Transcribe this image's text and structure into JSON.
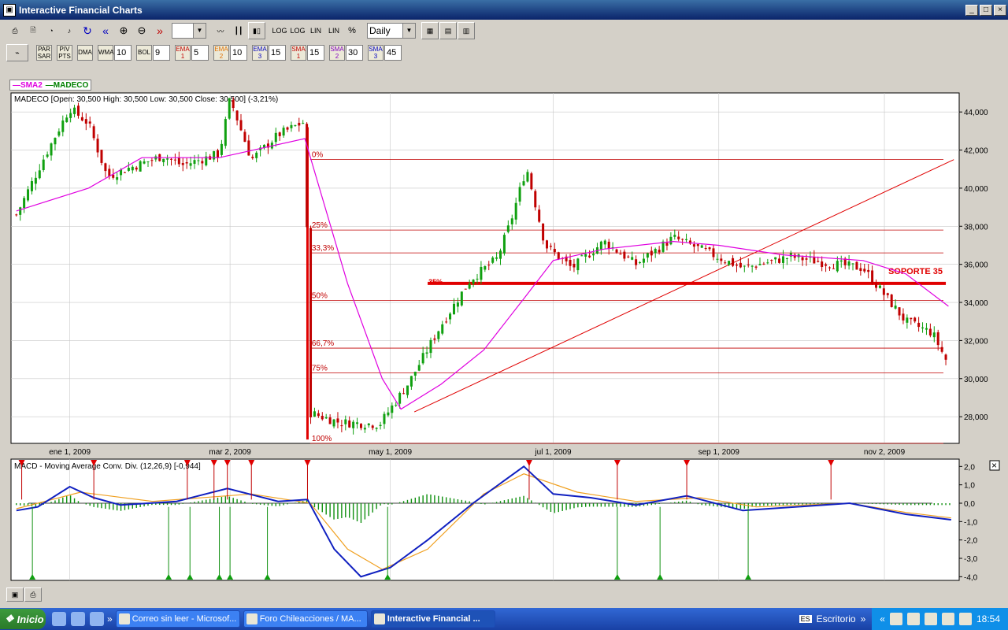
{
  "window": {
    "title": "Interactive Financial Charts"
  },
  "toolbar1": {
    "log1": "LOG",
    "log2": "LOG",
    "lin1": "LIN",
    "lin2": "LIN",
    "pct": "%",
    "period": "Daily"
  },
  "toolbar2": {
    "par": "PAR SAR",
    "piv": "PIV PTS",
    "dma": "DMA",
    "wma": "WMA",
    "wma_val": "10",
    "bol": "BOL",
    "bol_val": "9",
    "ema1": "EMA 1",
    "ema1_val": "5",
    "ema2": "EMA 2",
    "ema2_val": "10",
    "ema3": "EMA 3",
    "ema3_val": "15",
    "sma1": "SMA 1",
    "sma1_val": "15",
    "sma2": "SMA 2",
    "sma2_val": "30",
    "sma3": "SMA 3",
    "sma3_val": "45"
  },
  "legend": {
    "sma": "SMA2",
    "symbol": "MADECO",
    "sma_color": "#e000e0",
    "symbol_color": "#008000"
  },
  "chart_data": [
    {
      "type": "candlestick",
      "title": "MADECO [Open: 30,500  High: 30,500  Low: 30,500  Close: 30,500] (-3,21%)",
      "ylim": [
        26600,
        45000
      ],
      "y_ticks": [
        "44,000",
        "42,000",
        "40,000",
        "38,000",
        "36,000",
        "34,000",
        "32,000",
        "30,000",
        "28,000"
      ],
      "y_tick_values": [
        44000,
        42000,
        40000,
        38000,
        36000,
        34000,
        32000,
        30000,
        28000
      ],
      "x_ticks": [
        "ene 1, 2009",
        "mar 2, 2009",
        "may 1, 2009",
        "jul 1, 2009",
        "sep 1, 2009",
        "nov 2, 2009"
      ],
      "x_range": [
        "2008-12-10",
        "2009-11-30"
      ],
      "close_path": [
        {
          "d": "2008-12-12",
          "v": 38600
        },
        {
          "d": "2008-12-22",
          "v": 41500
        },
        {
          "d": "2009-01-01",
          "v": 44200
        },
        {
          "d": "2009-01-08",
          "v": 43400
        },
        {
          "d": "2009-01-15",
          "v": 40600
        },
        {
          "d": "2009-01-22",
          "v": 41000
        },
        {
          "d": "2009-02-05",
          "v": 41700
        },
        {
          "d": "2009-02-12",
          "v": 41200
        },
        {
          "d": "2009-02-26",
          "v": 41800
        },
        {
          "d": "2009-03-02",
          "v": 44700
        },
        {
          "d": "2009-03-10",
          "v": 41500
        },
        {
          "d": "2009-03-20",
          "v": 42800
        },
        {
          "d": "2009-03-30",
          "v": 43500
        },
        {
          "d": "2009-04-01",
          "v": 28200
        },
        {
          "d": "2009-04-12",
          "v": 27700
        },
        {
          "d": "2009-04-27",
          "v": 27600
        },
        {
          "d": "2009-05-08",
          "v": 29800
        },
        {
          "d": "2009-05-20",
          "v": 32800
        },
        {
          "d": "2009-05-31",
          "v": 35200
        },
        {
          "d": "2009-06-10",
          "v": 36300
        },
        {
          "d": "2009-06-15",
          "v": 38200
        },
        {
          "d": "2009-06-21",
          "v": 41100
        },
        {
          "d": "2009-06-28",
          "v": 37000
        },
        {
          "d": "2009-07-08",
          "v": 35800
        },
        {
          "d": "2009-07-20",
          "v": 37200
        },
        {
          "d": "2009-08-01",
          "v": 36000
        },
        {
          "d": "2009-08-15",
          "v": 37400
        },
        {
          "d": "2009-08-25",
          "v": 36800
        },
        {
          "d": "2009-09-10",
          "v": 35800
        },
        {
          "d": "2009-09-28",
          "v": 36400
        },
        {
          "d": "2009-10-10",
          "v": 36100
        },
        {
          "d": "2009-10-25",
          "v": 35800
        },
        {
          "d": "2009-11-02",
          "v": 34400
        },
        {
          "d": "2009-11-10",
          "v": 33000
        },
        {
          "d": "2009-11-20",
          "v": 32400
        },
        {
          "d": "2009-11-25",
          "v": 31000
        }
      ],
      "sma_path": [
        {
          "d": "2008-12-12",
          "v": 38800
        },
        {
          "d": "2009-01-08",
          "v": 40000
        },
        {
          "d": "2009-01-28",
          "v": 41600
        },
        {
          "d": "2009-02-26",
          "v": 41600
        },
        {
          "d": "2009-03-30",
          "v": 42600
        },
        {
          "d": "2009-04-15",
          "v": 35000
        },
        {
          "d": "2009-04-28",
          "v": 30000
        },
        {
          "d": "2009-05-05",
          "v": 28400
        },
        {
          "d": "2009-05-20",
          "v": 29700
        },
        {
          "d": "2009-06-05",
          "v": 31500
        },
        {
          "d": "2009-06-20",
          "v": 34200
        },
        {
          "d": "2009-07-01",
          "v": 36200
        },
        {
          "d": "2009-07-20",
          "v": 36800
        },
        {
          "d": "2009-08-15",
          "v": 37200
        },
        {
          "d": "2009-09-01",
          "v": 37000
        },
        {
          "d": "2009-09-25",
          "v": 36500
        },
        {
          "d": "2009-10-25",
          "v": 36200
        },
        {
          "d": "2009-11-10",
          "v": 35500
        },
        {
          "d": "2009-11-26",
          "v": 33800
        }
      ],
      "fibonacci": [
        {
          "label": "0%",
          "value": 41500
        },
        {
          "label": "25%",
          "value": 37800
        },
        {
          "label": "33,3%",
          "value": 36600
        },
        {
          "label": "50%",
          "value": 34100
        },
        {
          "label": "66,7%",
          "value": 31600
        },
        {
          "label": "75%",
          "value": 30300
        },
        {
          "label": "100%",
          "value": 26600
        }
      ],
      "support": {
        "label": "SOPORTE 35",
        "value": 35000,
        "overlay_label": "35%",
        "from": "2009-05-15",
        "to": "2009-11-25"
      },
      "trendline": {
        "from_d": "2009-05-10",
        "from_v": 28250,
        "to_d": "2009-11-28",
        "to_v": 41500
      },
      "drop_line": {
        "d": "2009-03-31",
        "from_v": 43200,
        "to_v": 26800
      }
    },
    {
      "type": "macd",
      "title": "MACD - Moving Average Conv. Div. (12,26,9) [-0,944]",
      "ylim": [
        -4.2,
        2.4
      ],
      "y_ticks": [
        "2,0",
        "1,0",
        "0,0",
        "-1,0",
        "-2,0",
        "-3,0",
        "-4,0"
      ],
      "y_tick_values": [
        2,
        1,
        0,
        -1,
        -2,
        -3,
        -4
      ],
      "macd": [
        {
          "d": "2008-12-12",
          "v": -0.4
        },
        {
          "d": "2008-12-20",
          "v": -0.2
        },
        {
          "d": "2009-01-01",
          "v": 0.9
        },
        {
          "d": "2009-01-10",
          "v": 0.3
        },
        {
          "d": "2009-01-20",
          "v": -0.1
        },
        {
          "d": "2009-02-10",
          "v": 0.1
        },
        {
          "d": "2009-03-01",
          "v": 0.8
        },
        {
          "d": "2009-03-20",
          "v": 0.1
        },
        {
          "d": "2009-03-31",
          "v": 0.2
        },
        {
          "d": "2009-04-10",
          "v": -2.5
        },
        {
          "d": "2009-04-20",
          "v": -4.0
        },
        {
          "d": "2009-05-01",
          "v": -3.5
        },
        {
          "d": "2009-05-15",
          "v": -2.0
        },
        {
          "d": "2009-06-01",
          "v": 0.0
        },
        {
          "d": "2009-06-20",
          "v": 2.0
        },
        {
          "d": "2009-07-01",
          "v": 0.5
        },
        {
          "d": "2009-07-15",
          "v": 0.3
        },
        {
          "d": "2009-08-01",
          "v": -0.1
        },
        {
          "d": "2009-08-20",
          "v": 0.4
        },
        {
          "d": "2009-09-10",
          "v": -0.4
        },
        {
          "d": "2009-10-20",
          "v": 0.0
        },
        {
          "d": "2009-11-10",
          "v": -0.6
        },
        {
          "d": "2009-11-27",
          "v": -0.9
        }
      ],
      "signal": [
        {
          "d": "2008-12-12",
          "v": -0.3
        },
        {
          "d": "2009-01-05",
          "v": 0.6
        },
        {
          "d": "2009-02-01",
          "v": 0.1
        },
        {
          "d": "2009-03-10",
          "v": 0.5
        },
        {
          "d": "2009-04-01",
          "v": 0.0
        },
        {
          "d": "2009-04-15",
          "v": -2.5
        },
        {
          "d": "2009-04-28",
          "v": -3.6
        },
        {
          "d": "2009-05-15",
          "v": -2.5
        },
        {
          "d": "2009-06-05",
          "v": 0.5
        },
        {
          "d": "2009-06-20",
          "v": 1.6
        },
        {
          "d": "2009-07-10",
          "v": 0.6
        },
        {
          "d": "2009-08-01",
          "v": 0.1
        },
        {
          "d": "2009-08-25",
          "v": 0.3
        },
        {
          "d": "2009-09-15",
          "v": -0.2
        },
        {
          "d": "2009-10-20",
          "v": 0.0
        },
        {
          "d": "2009-11-10",
          "v": -0.5
        },
        {
          "d": "2009-11-27",
          "v": -0.8
        }
      ],
      "sell_signals": [
        "2008-12-14",
        "2009-01-10",
        "2009-02-14",
        "2009-02-24",
        "2009-03-01",
        "2009-03-10",
        "2009-03-31",
        "2009-06-22",
        "2009-07-25",
        "2009-08-20",
        "2009-10-13"
      ],
      "buy_signals": [
        "2008-12-18",
        "2009-02-07",
        "2009-02-15",
        "2009-02-26",
        "2009-03-02",
        "2009-03-16",
        "2009-04-30",
        "2009-07-25",
        "2009-08-10",
        "2009-09-12"
      ]
    }
  ],
  "taskbar": {
    "start": "Inicio",
    "tasks": [
      "Correo sin leer - Microsof...",
      "Foro Chileacciones / MA...",
      "Interactive Financial ..."
    ],
    "desktop": "Escritorio",
    "clock": "18:54"
  }
}
